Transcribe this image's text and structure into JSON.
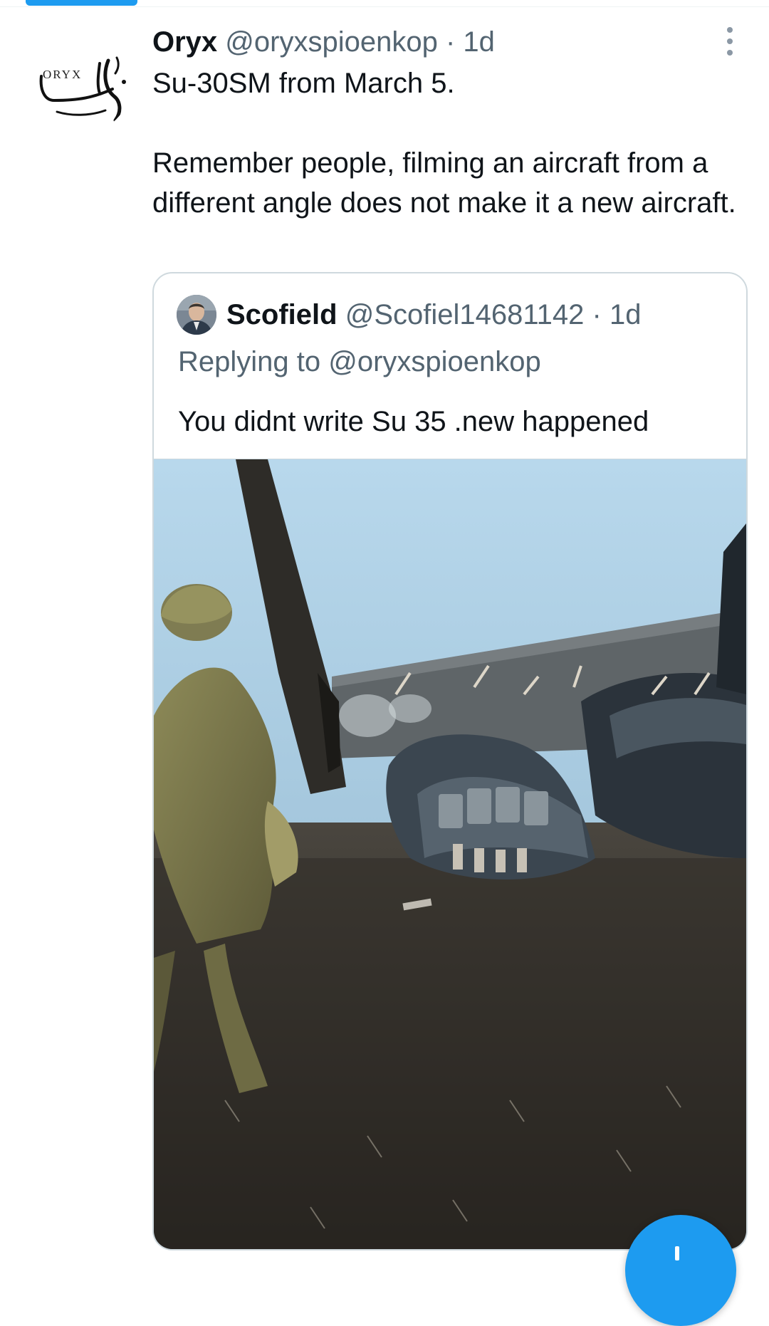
{
  "tweet": {
    "author": {
      "name": "Oryx",
      "handle": "@oryxspioenkop",
      "avatar": {
        "logo_text": "ORYX",
        "icon": "oryx-logo-icon"
      }
    },
    "separator": "·",
    "time": "1d",
    "text": "Su-30SM from March 5.\n\nRemember people, filming an aircraft from a different angle does not make it a new aircraft.",
    "more_icon": "more-vertical-icon"
  },
  "quoted_tweet": {
    "author": {
      "name": "Scofield",
      "handle": "@Scofiel14681142",
      "avatar_icon": "user-photo-icon"
    },
    "separator": "·",
    "time": "1d",
    "replying_to": "Replying to @oryxspioenkop",
    "text": "You didnt write Su 35 .new happened",
    "media": {
      "kind": "video-thumbnail",
      "icon": "aircraft-wreckage-photo"
    }
  },
  "compose_button": {
    "icon": "compose-plus-icon"
  },
  "colors": {
    "accent": "#1d9bf0",
    "text_primary": "#0f1419",
    "text_secondary": "#536471",
    "border": "#cfd9de"
  }
}
